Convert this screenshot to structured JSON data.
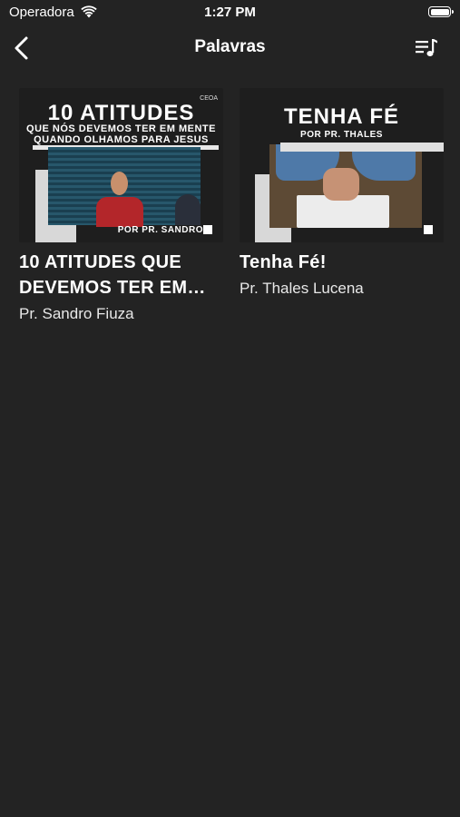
{
  "status_bar": {
    "carrier": "Operadora",
    "time": "1:27 PM"
  },
  "nav": {
    "title": "Palavras",
    "back_icon": "chevron-left-icon",
    "queue_icon": "playlist-music-icon"
  },
  "items": [
    {
      "title": "10 ATITUDES QUE DEVEMOS TER EM…",
      "subtitle": "Pr. Sandro Fiuza",
      "thumb": {
        "heading": "10 ATITUDES",
        "line2": "QUE NÓS DEVEMOS TER EM MENTE",
        "line3": "QUANDO OLHAMOS PARA JESUS",
        "byline": "POR PR. SANDRO",
        "logo": "CEOA"
      }
    },
    {
      "title": "Tenha Fé!",
      "subtitle": "Pr. Thales Lucena",
      "thumb": {
        "heading": "TENHA FÉ",
        "byline": "POR PR. THALES"
      }
    }
  ]
}
